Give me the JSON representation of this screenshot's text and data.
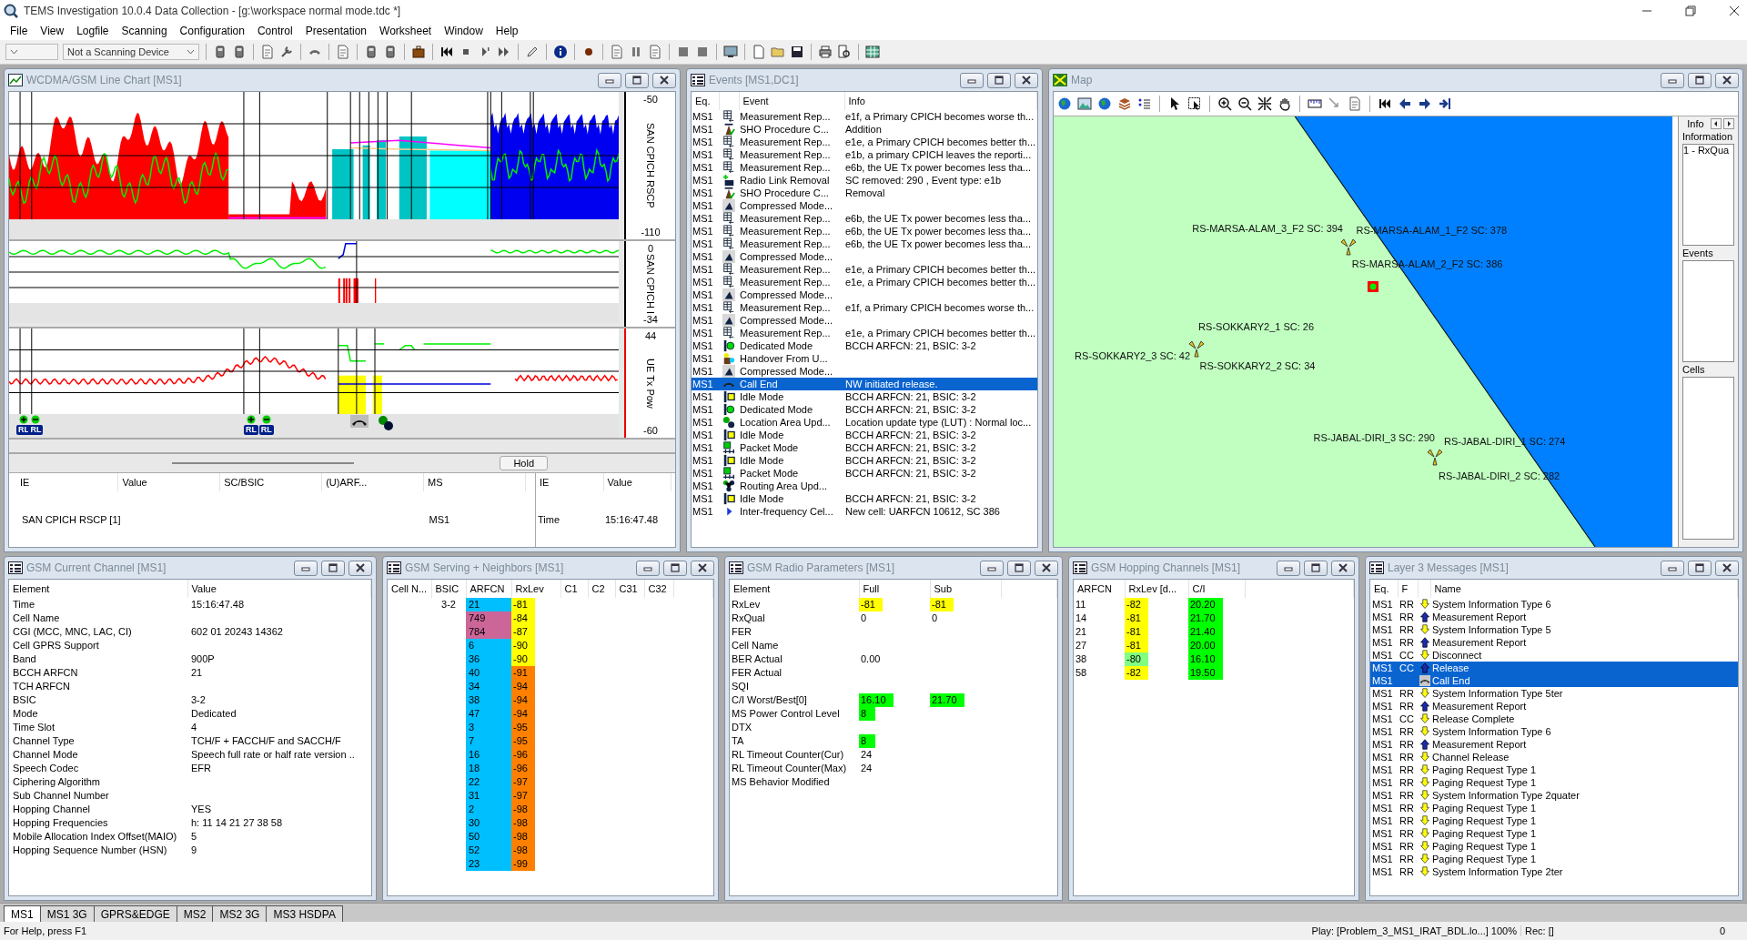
{
  "app_title": "TEMS Investigation 10.0.4 Data Collection - [g:\\workspace normal mode.tdc *]",
  "menu": [
    "File",
    "View",
    "Logfile",
    "Scanning",
    "Configuration",
    "Control",
    "Presentation",
    "Worksheet",
    "Window",
    "Help"
  ],
  "toolbar": {
    "scanning_device": "Not a Scanning Device"
  },
  "line_chart": {
    "title": "WCDMA/GSM Line Chart [MS1]",
    "panels": [
      {
        "kind": "rscp",
        "axis_label": "SAN CPICH RSCP",
        "max": "-50",
        "min": "-110"
      },
      {
        "kind": "ecio",
        "axis_label": "SAN CPICH I",
        "max": "0",
        "min": "-34"
      },
      {
        "kind": "txpower",
        "axis_label": "UE Tx Pow",
        "max": "44",
        "min": "-60"
      }
    ],
    "markers": [
      {
        "kind": "rl_add",
        "label": "RL"
      },
      {
        "kind": "rl_remove",
        "label": "RL"
      },
      {
        "kind": "rl_add",
        "label": "RL"
      },
      {
        "kind": "rl_remove",
        "label": "RL"
      },
      {
        "kind": "call_end"
      },
      {
        "kind": "location"
      }
    ],
    "hold_button": "Hold",
    "ie_table": {
      "columns": [
        "IE",
        "Value",
        "SC/BSIC",
        "(U)ARF...",
        "MS"
      ],
      "rows": [
        {
          "ie": "SAN CPICH RSCP [1]",
          "ms": "MS1"
        }
      ]
    },
    "info_table": {
      "columns": [
        "IE",
        "Value"
      ],
      "rows": [
        {
          "ie": "Time",
          "value": "15:16:47.48"
        }
      ]
    }
  },
  "events": {
    "title": "Events  [MS1,DC1]",
    "columns": [
      "Eq.",
      "Event",
      "Info"
    ],
    "rows": [
      {
        "eq": "MS1",
        "kind": "meas",
        "event": "Measurement Rep...",
        "info": "e1f, a Primary CPICH becomes worse th...",
        "selected": false
      },
      {
        "eq": "MS1",
        "kind": "sho",
        "event": "SHO Procedure C...",
        "info": "Addition",
        "selected": false
      },
      {
        "eq": "MS1",
        "kind": "meas",
        "event": "Measurement Rep...",
        "info": "e1e, a Primary CPICH becomes better th...",
        "selected": false
      },
      {
        "eq": "MS1",
        "kind": "meas",
        "event": "Measurement Rep...",
        "info": "e1b, a primary CPICH leaves the reporti...",
        "selected": false
      },
      {
        "eq": "MS1",
        "kind": "meas",
        "event": "Measurement Rep...",
        "info": "e6b, the UE Tx power becomes less tha...",
        "selected": false
      },
      {
        "eq": "MS1",
        "kind": "rl_removal",
        "event": "Radio Link Removal",
        "info": "SC removed: 290 , Event type: e1b",
        "selected": false
      },
      {
        "eq": "MS1",
        "kind": "sho",
        "event": "SHO Procedure C...",
        "info": "Removal",
        "selected": false
      },
      {
        "eq": "MS1",
        "kind": "compressed",
        "event": "Compressed Mode...",
        "selected": false
      },
      {
        "eq": "MS1",
        "kind": "meas",
        "event": "Measurement Rep...",
        "info": "e6b, the UE Tx power becomes less tha...",
        "selected": false
      },
      {
        "eq": "MS1",
        "kind": "meas",
        "event": "Measurement Rep...",
        "info": "e6b, the UE Tx power becomes less tha...",
        "selected": false
      },
      {
        "eq": "MS1",
        "kind": "meas",
        "event": "Measurement Rep...",
        "info": "e6b, the UE Tx power becomes less tha...",
        "selected": false
      },
      {
        "eq": "MS1",
        "kind": "compressed",
        "event": "Compressed Mode...",
        "selected": false
      },
      {
        "eq": "MS1",
        "kind": "meas",
        "event": "Measurement Rep...",
        "info": "e1e, a Primary CPICH becomes better th...",
        "selected": false
      },
      {
        "eq": "MS1",
        "kind": "meas",
        "event": "Measurement Rep...",
        "info": "e1e, a Primary CPICH becomes better th...",
        "selected": false
      },
      {
        "eq": "MS1",
        "kind": "compressed",
        "event": "Compressed Mode...",
        "selected": false
      },
      {
        "eq": "MS1",
        "kind": "meas",
        "event": "Measurement Rep...",
        "info": "e1f, a Primary CPICH becomes worse th...",
        "selected": false
      },
      {
        "eq": "MS1",
        "kind": "compressed",
        "event": "Compressed Mode...",
        "selected": false
      },
      {
        "eq": "MS1",
        "kind": "meas",
        "event": "Measurement Rep...",
        "info": "e1e, a Primary CPICH becomes better th...",
        "selected": false
      },
      {
        "eq": "MS1",
        "kind": "dedicated",
        "event": "Dedicated Mode",
        "info": "BCCH ARFCN: 21, BSIC: 3-2",
        "selected": false
      },
      {
        "eq": "MS1",
        "kind": "handover",
        "event": "Handover From U...",
        "selected": false
      },
      {
        "eq": "MS1",
        "kind": "compressed",
        "event": "Compressed Mode...",
        "selected": false
      },
      {
        "eq": "MS1",
        "kind": "call_end",
        "event": "Call End",
        "info": "NW initiated release.",
        "selected": true
      },
      {
        "eq": "MS1",
        "kind": "idle",
        "event": "Idle Mode",
        "info": "BCCH ARFCN: 21, BSIC: 3-2",
        "selected": false
      },
      {
        "eq": "MS1",
        "kind": "dedicated",
        "event": "Dedicated Mode",
        "info": "BCCH ARFCN: 21, BSIC: 3-2",
        "selected": false
      },
      {
        "eq": "MS1",
        "kind": "location",
        "event": "Location Area Upd...",
        "info": "Location update type (LUT) : Normal loc...",
        "selected": false
      },
      {
        "eq": "MS1",
        "kind": "idle",
        "event": "Idle Mode",
        "info": "BCCH ARFCN: 21, BSIC: 3-2",
        "selected": false
      },
      {
        "eq": "MS1",
        "kind": "packet",
        "event": "Packet Mode",
        "info": "BCCH ARFCN: 21, BSIC: 3-2",
        "selected": false
      },
      {
        "eq": "MS1",
        "kind": "idle",
        "event": "Idle Mode",
        "info": "BCCH ARFCN: 21, BSIC: 3-2",
        "selected": false
      },
      {
        "eq": "MS1",
        "kind": "packet",
        "event": "Packet Mode",
        "info": "BCCH ARFCN: 21, BSIC: 3-2",
        "selected": false
      },
      {
        "eq": "MS1",
        "kind": "routing",
        "event": "Routing Area Upd...",
        "selected": false
      },
      {
        "eq": "MS1",
        "kind": "idle",
        "event": "Idle Mode",
        "info": "BCCH ARFCN: 21, BSIC: 3-2",
        "selected": false
      },
      {
        "eq": "MS1",
        "kind": "interfreq",
        "event": "Inter-frequency Cel...",
        "info": "New cell: UARFCN 10612, SC 386",
        "selected": false
      }
    ]
  },
  "map": {
    "title": "Map",
    "cell_labels": [
      "RS-MARSA-ALAM_3_F2 SC: 394",
      "RS-MARSA-ALAM_1_F2 SC: 378",
      "RS-MARSA-ALAM_2_F2 SC: 386",
      "RS-SOKKARY2_1 SC: 26",
      "RS-SOKKARY2_3 SC: 42",
      "RS-SOKKARY2_2 SC: 34",
      "RS-JABAL-DIRI_3 SC: 290",
      "RS-JABAL-DIRI_1 SC: 274",
      "RS-JABAL-DIRI_2 SC: 282"
    ],
    "side_panel": {
      "tab": "Info",
      "information_label": "Information",
      "information_items": [
        "1 - RxQua"
      ],
      "events_label": "Events",
      "cells_label": "Cells"
    }
  },
  "current_channel": {
    "title": "GSM Current Channel [MS1]",
    "columns": [
      "Element",
      "Value"
    ],
    "rows": [
      {
        "element": "Time",
        "value": "15:16:47.48"
      },
      {
        "element": "Cell Name"
      },
      {
        "element": "CGI (MCC, MNC, LAC, CI)",
        "value": "602 01 20243 14362"
      },
      {
        "element": "Cell GPRS Support"
      },
      {
        "element": "Band",
        "value": "900P"
      },
      {
        "element": "BCCH ARFCN",
        "value": "21"
      },
      {
        "element": "TCH ARFCN"
      },
      {
        "element": "BSIC",
        "value": "3-2"
      },
      {
        "element": "Mode",
        "value": "Dedicated"
      },
      {
        "element": "Time Slot",
        "value": "4"
      },
      {
        "element": "Channel Type",
        "value": "TCH/F + FACCH/F and SACCH/F"
      },
      {
        "element": "Channel Mode",
        "value": "Speech full rate or half rate version .."
      },
      {
        "element": "Speech Codec",
        "value": "EFR"
      },
      {
        "element": "Ciphering Algorithm"
      },
      {
        "element": "Sub Channel Number"
      },
      {
        "element": "Hopping Channel",
        "value": "YES"
      },
      {
        "element": "Hopping Frequencies",
        "value": "h: 11 14 21 27 38 58"
      },
      {
        "element": "Mobile Allocation Index Offset(MAIO)",
        "value": "5"
      },
      {
        "element": "Hopping Sequence Number (HSN)",
        "value": "9"
      }
    ]
  },
  "serving_neighbors": {
    "title": "GSM Serving + Neighbors [MS1]",
    "columns": [
      "Cell N...",
      "BSIC",
      "ARFCN",
      "RxLev",
      "C1",
      "C2",
      "C31",
      "C32"
    ],
    "rows": [
      {
        "bsic": "3-2",
        "arfcn": {
          "text": "21",
          "color": "#00bfff"
        },
        "rxlev": {
          "text": "-81",
          "color": "#ffff00"
        }
      },
      {
        "arfcn": {
          "text": "749",
          "color": "#cc6699"
        },
        "rxlev": {
          "text": "-84",
          "color": "#ffff00"
        }
      },
      {
        "arfcn": {
          "text": "784",
          "color": "#cc6699"
        },
        "rxlev": {
          "text": "-87",
          "color": "#ffff00"
        }
      },
      {
        "arfcn": {
          "text": "6",
          "color": "#00bfff"
        },
        "rxlev": {
          "text": "-90",
          "color": "#ffff00"
        }
      },
      {
        "arfcn": {
          "text": "36",
          "color": "#00bfff"
        },
        "rxlev": {
          "text": "-90",
          "color": "#ffff00"
        }
      },
      {
        "arfcn": {
          "text": "40",
          "color": "#00bfff"
        },
        "rxlev": {
          "text": "-91",
          "color": "#ff8000"
        }
      },
      {
        "arfcn": {
          "text": "34",
          "color": "#00bfff"
        },
        "rxlev": {
          "text": "-94",
          "color": "#ff8000"
        }
      },
      {
        "arfcn": {
          "text": "38",
          "color": "#00bfff"
        },
        "rxlev": {
          "text": "-94",
          "color": "#ff8000"
        }
      },
      {
        "arfcn": {
          "text": "47",
          "color": "#00bfff"
        },
        "rxlev": {
          "text": "-94",
          "color": "#ff8000"
        }
      },
      {
        "arfcn": {
          "text": "3",
          "color": "#00bfff"
        },
        "rxlev": {
          "text": "-95",
          "color": "#ff8000"
        }
      },
      {
        "arfcn": {
          "text": "7",
          "color": "#00bfff"
        },
        "rxlev": {
          "text": "-95",
          "color": "#ff8000"
        }
      },
      {
        "arfcn": {
          "text": "16",
          "color": "#00bfff"
        },
        "rxlev": {
          "text": "-96",
          "color": "#ff8000"
        }
      },
      {
        "arfcn": {
          "text": "18",
          "color": "#00bfff"
        },
        "rxlev": {
          "text": "-96",
          "color": "#ff8000"
        }
      },
      {
        "arfcn": {
          "text": "22",
          "color": "#00bfff"
        },
        "rxlev": {
          "text": "-97",
          "color": "#ff8000"
        }
      },
      {
        "arfcn": {
          "text": "31",
          "color": "#00bfff"
        },
        "rxlev": {
          "text": "-97",
          "color": "#ff8000"
        }
      },
      {
        "arfcn": {
          "text": "2",
          "color": "#00bfff"
        },
        "rxlev": {
          "text": "-98",
          "color": "#ff8000"
        }
      },
      {
        "arfcn": {
          "text": "30",
          "color": "#00bfff"
        },
        "rxlev": {
          "text": "-98",
          "color": "#ff8000"
        }
      },
      {
        "arfcn": {
          "text": "50",
          "color": "#00bfff"
        },
        "rxlev": {
          "text": "-98",
          "color": "#ff8000"
        }
      },
      {
        "arfcn": {
          "text": "52",
          "color": "#00bfff"
        },
        "rxlev": {
          "text": "-98",
          "color": "#ff8000"
        }
      },
      {
        "arfcn": {
          "text": "23",
          "color": "#00bfff"
        },
        "rxlev": {
          "text": "-99",
          "color": "#ff8000"
        }
      }
    ]
  },
  "radio_parameters": {
    "title": "GSM Radio Parameters [MS1]",
    "columns": [
      "Element",
      "Full",
      "Sub"
    ],
    "rows": [
      {
        "element": "RxLev",
        "full": {
          "text": "-81",
          "color": "#ffff00"
        },
        "sub": {
          "text": "-81",
          "color": "#ffff00"
        }
      },
      {
        "element": "RxQual",
        "full": {
          "text": "0"
        },
        "sub": {
          "text": "0"
        }
      },
      {
        "element": "FER"
      },
      {
        "element": "Cell Name"
      },
      {
        "element": "BER Actual",
        "full": {
          "text": "0.00"
        }
      },
      {
        "element": "FER Actual"
      },
      {
        "element": "SQI"
      },
      {
        "element": "C/I Worst/Best[0]",
        "full": {
          "text": "16.10",
          "color": "#00ff00"
        },
        "sub": {
          "text": "21.70",
          "color": "#00ff00"
        }
      },
      {
        "element": "MS Power Control Level",
        "full": {
          "text": "8",
          "color": "#00ff00"
        }
      },
      {
        "element": "DTX"
      },
      {
        "element": "TA",
        "full": {
          "text": "8",
          "color": "#00ff00"
        }
      },
      {
        "element": "RL Timeout Counter(Cur)",
        "full": {
          "text": "24"
        }
      },
      {
        "element": "RL Timeout Counter(Max)",
        "full": {
          "text": "24"
        }
      },
      {
        "element": "MS Behavior Modified"
      }
    ]
  },
  "hopping_channels": {
    "title": "GSM Hopping Channels [MS1]",
    "columns": [
      "ARFCN",
      "RxLev [d...",
      "C/I"
    ],
    "rows": [
      {
        "arfcn": "11",
        "rxlev": {
          "text": "-82",
          "color": "#ffff00"
        },
        "ci": {
          "text": "20.20",
          "color": "#00ff00"
        }
      },
      {
        "arfcn": "14",
        "rxlev": {
          "text": "-81",
          "color": "#ffff00"
        },
        "ci": {
          "text": "21.70",
          "color": "#00ff00"
        }
      },
      {
        "arfcn": "21",
        "rxlev": {
          "text": "-81",
          "color": "#ffff00"
        },
        "ci": {
          "text": "21.40",
          "color": "#00ff00"
        }
      },
      {
        "arfcn": "27",
        "rxlev": {
          "text": "-81",
          "color": "#ffff00"
        },
        "ci": {
          "text": "20.00",
          "color": "#00ff00"
        }
      },
      {
        "arfcn": "38",
        "rxlev": {
          "text": "-80",
          "color": "#80ff80"
        },
        "ci": {
          "text": "16.10",
          "color": "#00ff00"
        }
      },
      {
        "arfcn": "58",
        "rxlev": {
          "text": "-82",
          "color": "#ffff00"
        },
        "ci": {
          "text": "19.50",
          "color": "#00ff00"
        }
      }
    ]
  },
  "layer3": {
    "title": "Layer 3 Messages  [MS1]",
    "columns": [
      "Eq.",
      "F",
      "Name"
    ],
    "rows": [
      {
        "eq": "MS1",
        "protocol": "RR",
        "kind": "down",
        "name": "System Information Type 6",
        "selected": false
      },
      {
        "eq": "MS1",
        "protocol": "RR",
        "kind": "up",
        "name": "Measurement Report",
        "selected": false
      },
      {
        "eq": "MS1",
        "protocol": "RR",
        "kind": "down",
        "name": "System Information Type 5",
        "selected": false
      },
      {
        "eq": "MS1",
        "protocol": "RR",
        "kind": "up",
        "name": "Measurement Report",
        "selected": false
      },
      {
        "eq": "MS1",
        "protocol": "CC",
        "kind": "down",
        "name": "Disconnect",
        "selected": false
      },
      {
        "eq": "MS1",
        "protocol": "CC",
        "kind": "up",
        "name": "Release",
        "selected": true
      },
      {
        "eq": "MS1",
        "kind": "call_end",
        "name": "Call End",
        "selected": true
      },
      {
        "eq": "MS1",
        "protocol": "RR",
        "kind": "down",
        "name": "System Information Type 5ter",
        "selected": false
      },
      {
        "eq": "MS1",
        "protocol": "RR",
        "kind": "up",
        "name": "Measurement Report",
        "selected": false
      },
      {
        "eq": "MS1",
        "protocol": "CC",
        "kind": "down",
        "name": "Release Complete",
        "selected": false
      },
      {
        "eq": "MS1",
        "protocol": "RR",
        "kind": "down",
        "name": "System Information Type 6",
        "selected": false
      },
      {
        "eq": "MS1",
        "protocol": "RR",
        "kind": "up",
        "name": "Measurement Report",
        "selected": false
      },
      {
        "eq": "MS1",
        "protocol": "RR",
        "kind": "down",
        "name": "Channel Release",
        "selected": false
      },
      {
        "eq": "MS1",
        "protocol": "RR",
        "kind": "down",
        "name": "Paging Request Type 1",
        "selected": false
      },
      {
        "eq": "MS1",
        "protocol": "RR",
        "kind": "down",
        "name": "Paging Request Type 1",
        "selected": false
      },
      {
        "eq": "MS1",
        "protocol": "RR",
        "kind": "down",
        "name": "System Information Type 2quater",
        "selected": false
      },
      {
        "eq": "MS1",
        "protocol": "RR",
        "kind": "down",
        "name": "Paging Request Type 1",
        "selected": false
      },
      {
        "eq": "MS1",
        "protocol": "RR",
        "kind": "down",
        "name": "Paging Request Type 1",
        "selected": false
      },
      {
        "eq": "MS1",
        "protocol": "RR",
        "kind": "down",
        "name": "Paging Request Type 1",
        "selected": false
      },
      {
        "eq": "MS1",
        "protocol": "RR",
        "kind": "down",
        "name": "Paging Request Type 1",
        "selected": false
      },
      {
        "eq": "MS1",
        "protocol": "RR",
        "kind": "down",
        "name": "Paging Request Type 1",
        "selected": false
      },
      {
        "eq": "MS1",
        "protocol": "RR",
        "kind": "down",
        "name": "System Information Type 2ter",
        "selected": false
      }
    ]
  },
  "worksheet_tabs": [
    {
      "label": "MS1",
      "selected": true
    },
    {
      "label": "MS1 3G",
      "selected": false
    },
    {
      "label": "GPRS&EDGE",
      "selected": false
    },
    {
      "label": "MS2",
      "selected": false
    },
    {
      "label": "MS2 3G",
      "selected": false
    },
    {
      "label": "MS3 HSDPA",
      "selected": false
    }
  ],
  "status_bar": {
    "help": "For Help, press F1",
    "playback": "Play: [Problem_3_MS1_IRAT_BDL.lo...] 100%",
    "record": "Rec: []",
    "count": "0"
  }
}
